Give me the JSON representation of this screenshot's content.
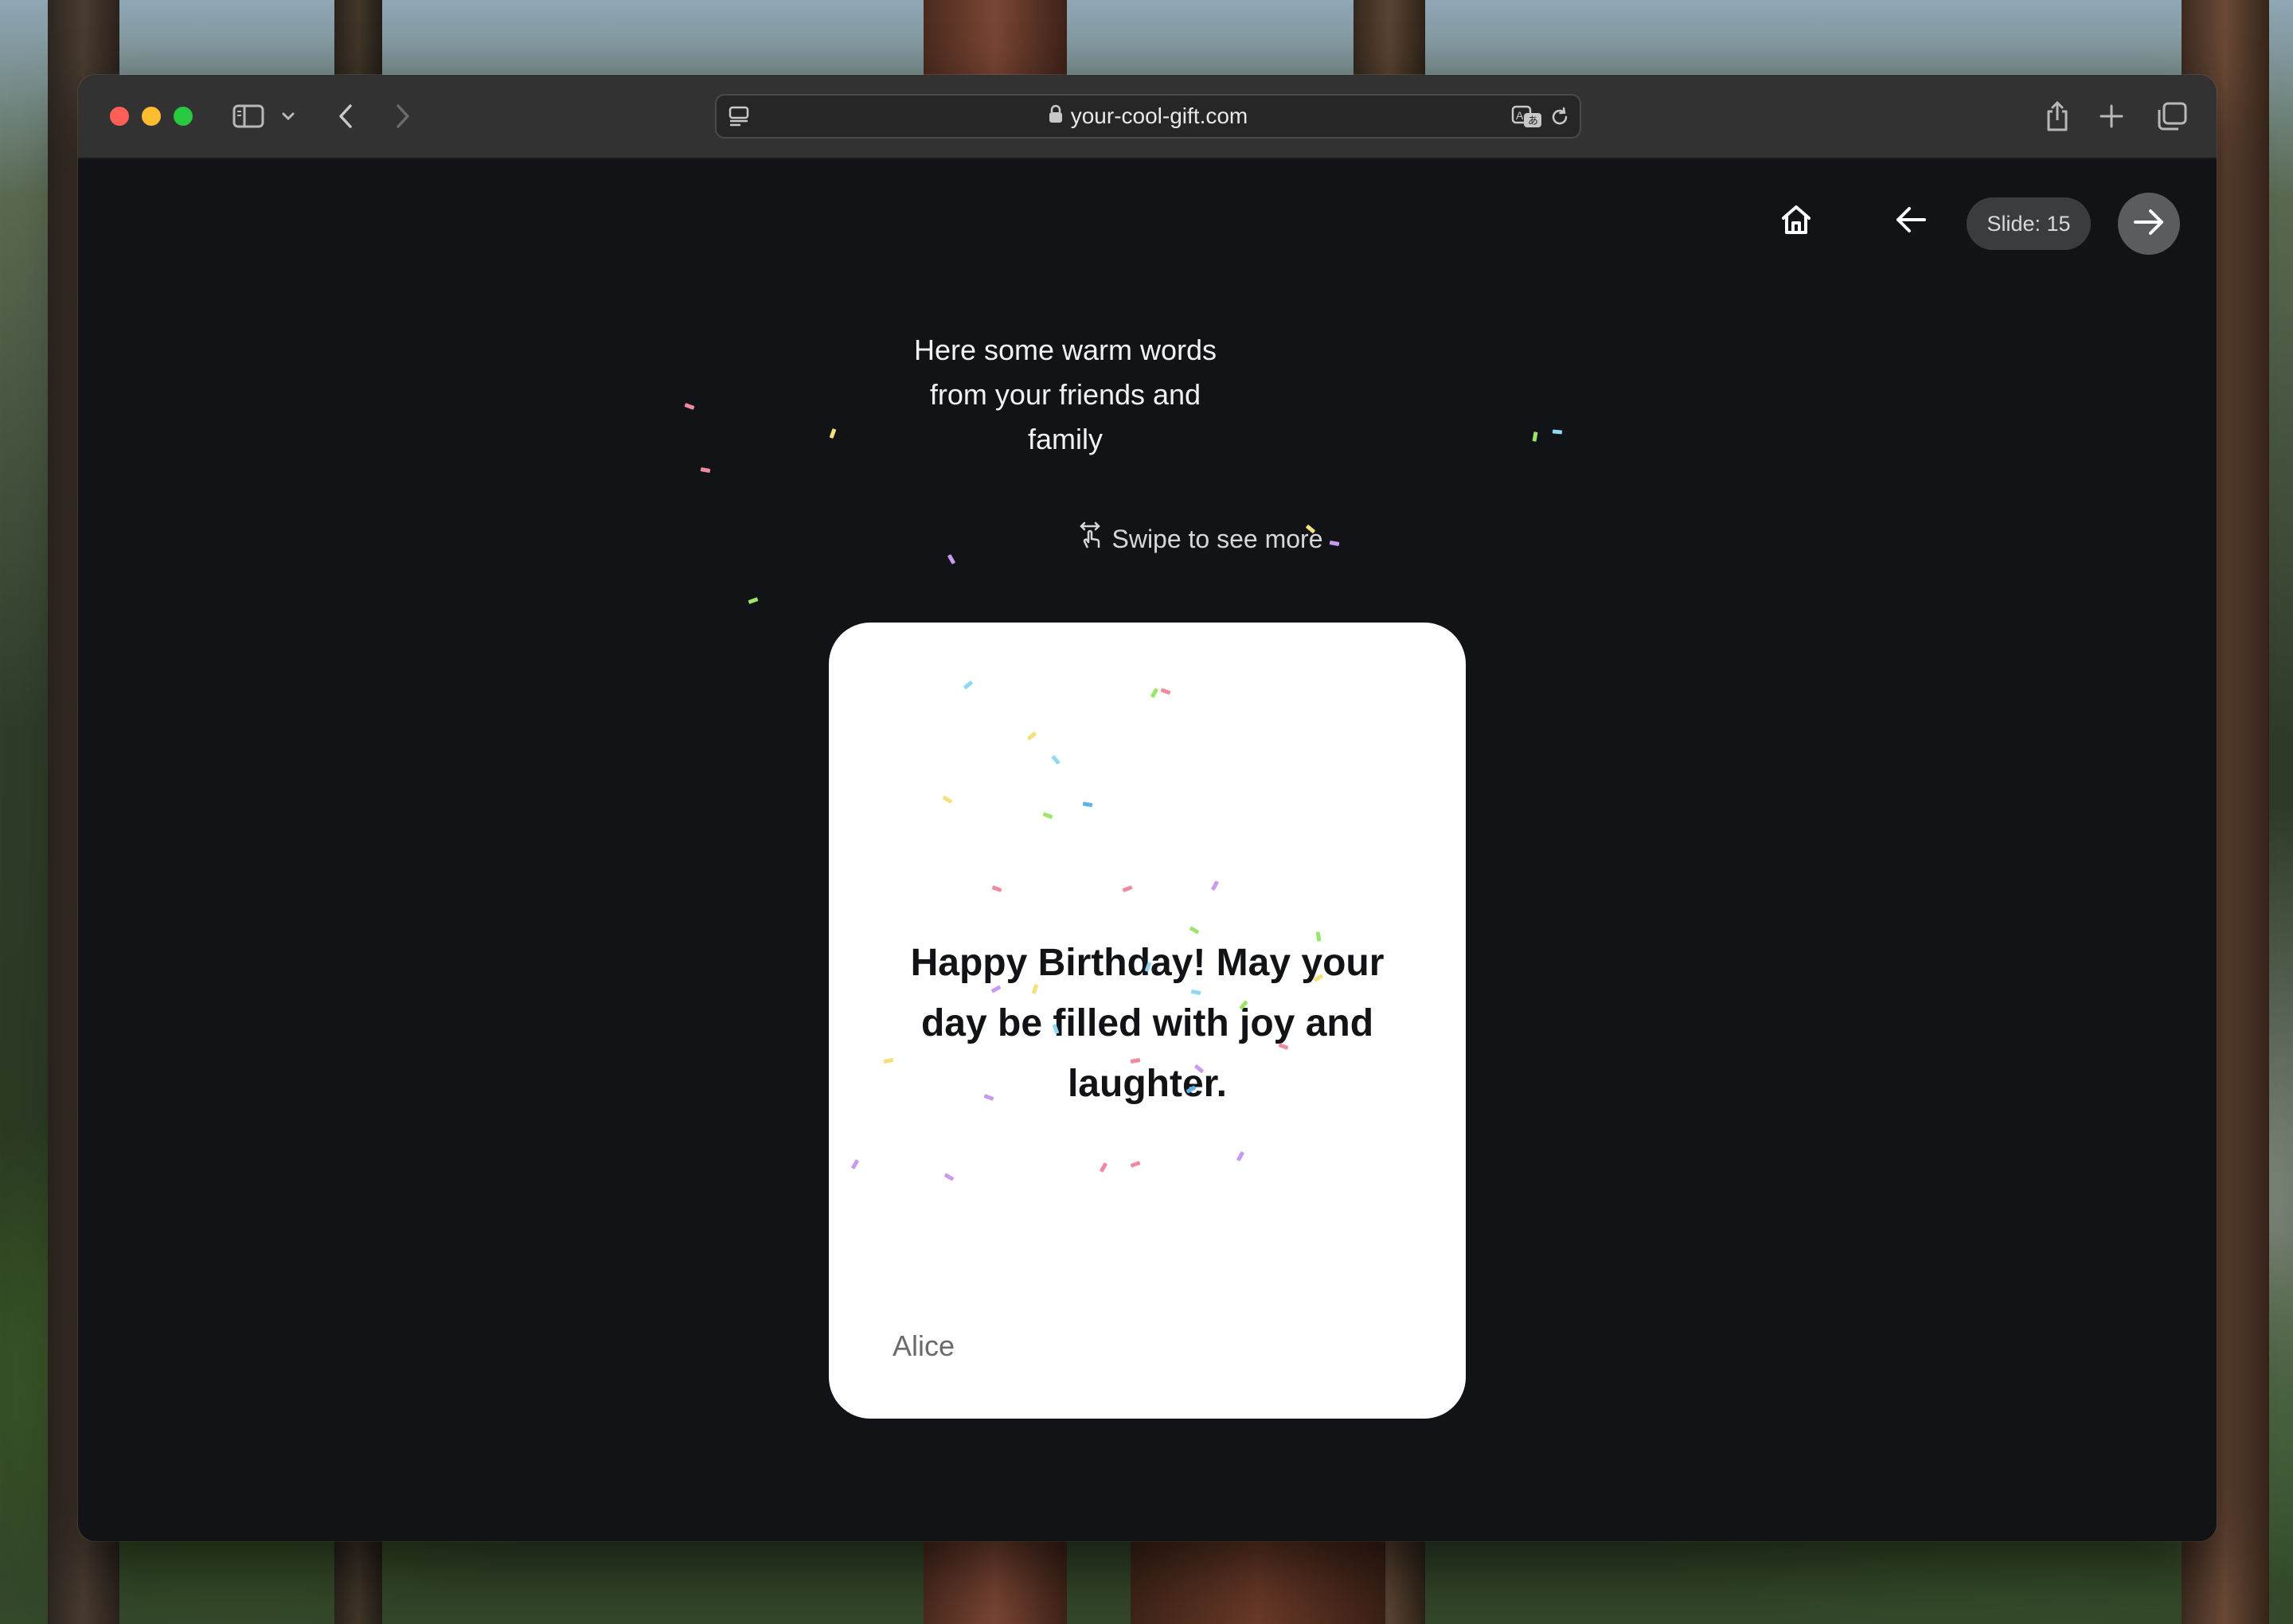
{
  "browser": {
    "url": "your-cool-gift.com",
    "icons": [
      "sidebar-icon",
      "chevron-down-icon",
      "back-icon",
      "forward-icon",
      "reader-icon",
      "lock-icon",
      "translate-icon",
      "reload-icon",
      "share-icon",
      "plus-icon",
      "tabs-icon"
    ]
  },
  "page": {
    "nav": {
      "slide_label": "Slide: 15",
      "icons": [
        "home-icon",
        "arrow-left-icon",
        "arrow-right-icon"
      ]
    },
    "intro_text": "Here some warm words from your friends and family",
    "swipe_hint": "Swipe to see more",
    "card": {
      "message": "Happy Birthday! May your day be filled with joy and laughter.",
      "author": "Alice"
    }
  },
  "colors": {
    "page_background": "#121316",
    "card_background": "#ffffff",
    "next_button": "#5b5c60",
    "slide_pill": "#3b3c3f",
    "confetti": [
      "#f08aa0",
      "#8fd7f5",
      "#c89af0",
      "#9be66a",
      "#f5e07a",
      "#5fb3e6"
    ]
  }
}
